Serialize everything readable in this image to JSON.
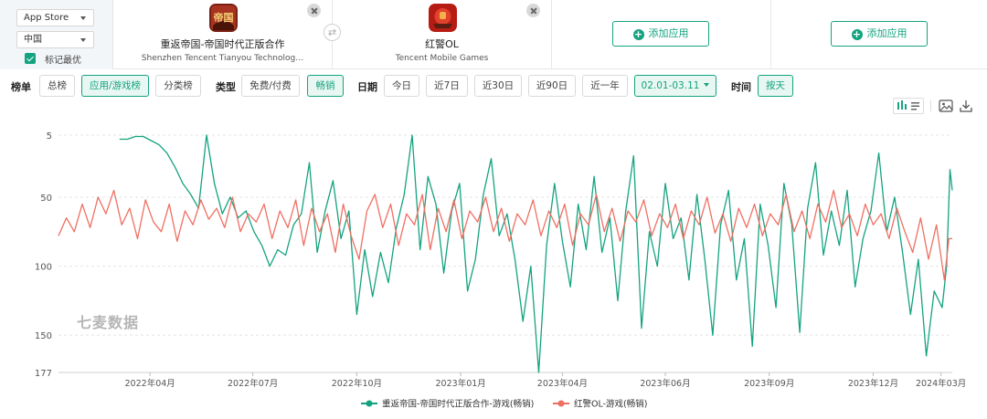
{
  "store_select": {
    "value": "App Store"
  },
  "region_select": {
    "value": "中国"
  },
  "mark_best": {
    "label": "标记最优",
    "checked": true
  },
  "apps": [
    {
      "name": "重返帝国-帝国时代正版合作",
      "developer": "Shenzhen Tencent Tianyou Technolog…",
      "icon": "icon-empire-game"
    },
    {
      "name": "红警OL",
      "developer": "Tencent Mobile Games",
      "icon": "icon-red-alert-game"
    }
  ],
  "add_app_label": "添加应用",
  "filters": {
    "chart_label": "榜单",
    "chart_options": [
      "总榜",
      "应用/游戏榜",
      "分类榜"
    ],
    "chart_selected": "应用/游戏榜",
    "type_label": "类型",
    "type_options": [
      "免费/付费",
      "畅销"
    ],
    "type_selected": "畅销",
    "date_label": "日期",
    "date_options": [
      "今日",
      "近7日",
      "近30日",
      "近90日",
      "近一年"
    ],
    "date_range": "02.01-03.11",
    "time_label": "时间",
    "time_selected": "按天"
  },
  "colors": {
    "accent": "#14a37f",
    "series1": "#14a37f",
    "series2": "#ef6f63"
  },
  "watermark": "七麦数据",
  "chart_data": {
    "type": "line",
    "y_inverted": true,
    "ylim": [
      5,
      177
    ],
    "y_ticks": [
      5,
      50,
      100,
      150,
      177
    ],
    "x_range": [
      "2022-01-10",
      "2024-03-11"
    ],
    "x_ticks": [
      {
        "date": "2022-04-01",
        "label": "2022年04月"
      },
      {
        "date": "2022-07-01",
        "label": "2022年07月"
      },
      {
        "date": "2022-10-01",
        "label": "2022年10月"
      },
      {
        "date": "2023-01-01",
        "label": "2023年01月"
      },
      {
        "date": "2023-04-01",
        "label": "2023年04月"
      },
      {
        "date": "2023-07-01",
        "label": "2023年06月"
      },
      {
        "date": "2023-10-01",
        "label": "2023年09月"
      },
      {
        "date": "2024-01-01",
        "label": "2023年12月"
      },
      {
        "date": "2024-03-01",
        "label": "2024年03月"
      }
    ],
    "grid": true,
    "legend_position": "bottom",
    "series": [
      {
        "name": "重返帝国-帝国时代正版合作-游戏(畅销)",
        "color": "#14a37f",
        "points": [
          [
            "2022-03-05",
            8
          ],
          [
            "2022-03-12",
            8
          ],
          [
            "2022-03-19",
            6
          ],
          [
            "2022-03-26",
            6
          ],
          [
            "2022-04-02",
            9
          ],
          [
            "2022-04-09",
            12
          ],
          [
            "2022-04-16",
            18
          ],
          [
            "2022-04-23",
            28
          ],
          [
            "2022-04-30",
            40
          ],
          [
            "2022-05-07",
            48
          ],
          [
            "2022-05-14",
            58
          ],
          [
            "2022-05-21",
            5
          ],
          [
            "2022-05-28",
            40
          ],
          [
            "2022-06-04",
            62
          ],
          [
            "2022-06-11",
            50
          ],
          [
            "2022-06-18",
            65
          ],
          [
            "2022-06-25",
            60
          ],
          [
            "2022-07-02",
            75
          ],
          [
            "2022-07-09",
            85
          ],
          [
            "2022-07-16",
            100
          ],
          [
            "2022-07-23",
            88
          ],
          [
            "2022-07-30",
            92
          ],
          [
            "2022-08-06",
            70
          ],
          [
            "2022-08-13",
            62
          ],
          [
            "2022-08-20",
            25
          ],
          [
            "2022-08-27",
            90
          ],
          [
            "2022-09-03",
            60
          ],
          [
            "2022-09-10",
            38
          ],
          [
            "2022-09-17",
            80
          ],
          [
            "2022-09-24",
            60
          ],
          [
            "2022-10-01",
            135
          ],
          [
            "2022-10-08",
            88
          ],
          [
            "2022-10-15",
            122
          ],
          [
            "2022-10-22",
            90
          ],
          [
            "2022-10-29",
            112
          ],
          [
            "2022-11-05",
            72
          ],
          [
            "2022-11-12",
            48
          ],
          [
            "2022-11-19",
            5
          ],
          [
            "2022-11-26",
            88
          ],
          [
            "2022-12-03",
            35
          ],
          [
            "2022-12-10",
            55
          ],
          [
            "2022-12-17",
            105
          ],
          [
            "2022-12-24",
            60
          ],
          [
            "2022-12-31",
            40
          ],
          [
            "2023-01-07",
            118
          ],
          [
            "2023-01-14",
            95
          ],
          [
            "2023-01-21",
            48
          ],
          [
            "2023-01-28",
            22
          ],
          [
            "2023-02-04",
            78
          ],
          [
            "2023-02-11",
            62
          ],
          [
            "2023-02-18",
            95
          ],
          [
            "2023-02-25",
            140
          ],
          [
            "2023-03-04",
            100
          ],
          [
            "2023-03-11",
            177
          ],
          [
            "2023-03-18",
            85
          ],
          [
            "2023-03-25",
            40
          ],
          [
            "2023-04-01",
            82
          ],
          [
            "2023-04-08",
            115
          ],
          [
            "2023-04-15",
            55
          ],
          [
            "2023-04-22",
            88
          ],
          [
            "2023-04-29",
            35
          ],
          [
            "2023-05-06",
            90
          ],
          [
            "2023-05-13",
            65
          ],
          [
            "2023-05-20",
            125
          ],
          [
            "2023-05-27",
            60
          ],
          [
            "2023-06-03",
            20
          ],
          [
            "2023-06-10",
            145
          ],
          [
            "2023-06-17",
            75
          ],
          [
            "2023-06-24",
            100
          ],
          [
            "2023-07-01",
            40
          ],
          [
            "2023-07-08",
            80
          ],
          [
            "2023-07-15",
            65
          ],
          [
            "2023-07-22",
            110
          ],
          [
            "2023-07-29",
            48
          ],
          [
            "2023-08-05",
            95
          ],
          [
            "2023-08-12",
            150
          ],
          [
            "2023-08-19",
            70
          ],
          [
            "2023-08-26",
            45
          ],
          [
            "2023-09-02",
            110
          ],
          [
            "2023-09-09",
            80
          ],
          [
            "2023-09-16",
            158
          ],
          [
            "2023-09-23",
            55
          ],
          [
            "2023-09-30",
            85
          ],
          [
            "2023-10-07",
            130
          ],
          [
            "2023-10-14",
            40
          ],
          [
            "2023-10-21",
            70
          ],
          [
            "2023-10-28",
            148
          ],
          [
            "2023-11-04",
            58
          ],
          [
            "2023-11-11",
            25
          ],
          [
            "2023-11-18",
            92
          ],
          [
            "2023-11-25",
            60
          ],
          [
            "2023-12-02",
            85
          ],
          [
            "2023-12-09",
            45
          ],
          [
            "2023-12-16",
            115
          ],
          [
            "2023-12-23",
            80
          ],
          [
            "2023-12-30",
            60
          ],
          [
            "2024-01-06",
            18
          ],
          [
            "2024-01-13",
            75
          ],
          [
            "2024-01-20",
            50
          ],
          [
            "2024-01-27",
            90
          ],
          [
            "2024-02-03",
            135
          ],
          [
            "2024-02-10",
            95
          ],
          [
            "2024-02-17",
            165
          ],
          [
            "2024-02-24",
            118
          ],
          [
            "2024-03-02",
            130
          ],
          [
            "2024-03-06",
            100
          ],
          [
            "2024-03-09",
            30
          ],
          [
            "2024-03-11",
            45
          ]
        ]
      },
      {
        "name": "红警OL-游戏(畅销)",
        "color": "#ef6f63",
        "points": [
          [
            "2022-01-10",
            78
          ],
          [
            "2022-01-17",
            65
          ],
          [
            "2022-01-24",
            75
          ],
          [
            "2022-01-31",
            55
          ],
          [
            "2022-02-07",
            72
          ],
          [
            "2022-02-14",
            50
          ],
          [
            "2022-02-21",
            62
          ],
          [
            "2022-02-28",
            45
          ],
          [
            "2022-03-07",
            70
          ],
          [
            "2022-03-14",
            58
          ],
          [
            "2022-03-21",
            80
          ],
          [
            "2022-03-28",
            52
          ],
          [
            "2022-04-04",
            68
          ],
          [
            "2022-04-11",
            75
          ],
          [
            "2022-04-18",
            55
          ],
          [
            "2022-04-25",
            82
          ],
          [
            "2022-05-02",
            60
          ],
          [
            "2022-05-09",
            70
          ],
          [
            "2022-05-16",
            52
          ],
          [
            "2022-05-23",
            66
          ],
          [
            "2022-05-30",
            58
          ],
          [
            "2022-06-06",
            72
          ],
          [
            "2022-06-13",
            50
          ],
          [
            "2022-06-20",
            75
          ],
          [
            "2022-06-27",
            62
          ],
          [
            "2022-07-04",
            68
          ],
          [
            "2022-07-11",
            55
          ],
          [
            "2022-07-18",
            80
          ],
          [
            "2022-07-25",
            60
          ],
          [
            "2022-08-01",
            72
          ],
          [
            "2022-08-08",
            52
          ],
          [
            "2022-08-15",
            85
          ],
          [
            "2022-08-22",
            58
          ],
          [
            "2022-08-29",
            75
          ],
          [
            "2022-09-05",
            62
          ],
          [
            "2022-09-12",
            90
          ],
          [
            "2022-09-19",
            55
          ],
          [
            "2022-09-26",
            78
          ],
          [
            "2022-10-03",
            95
          ],
          [
            "2022-10-10",
            60
          ],
          [
            "2022-10-17",
            48
          ],
          [
            "2022-10-24",
            72
          ],
          [
            "2022-10-31",
            55
          ],
          [
            "2022-11-07",
            85
          ],
          [
            "2022-11-14",
            62
          ],
          [
            "2022-11-21",
            70
          ],
          [
            "2022-11-28",
            48
          ],
          [
            "2022-12-05",
            88
          ],
          [
            "2022-12-12",
            58
          ],
          [
            "2022-12-19",
            75
          ],
          [
            "2022-12-26",
            52
          ],
          [
            "2023-01-02",
            80
          ],
          [
            "2023-01-09",
            60
          ],
          [
            "2023-01-16",
            68
          ],
          [
            "2023-01-23",
            50
          ],
          [
            "2023-01-30",
            75
          ],
          [
            "2023-02-06",
            58
          ],
          [
            "2023-02-13",
            82
          ],
          [
            "2023-02-20",
            62
          ],
          [
            "2023-02-27",
            70
          ],
          [
            "2023-03-06",
            52
          ],
          [
            "2023-03-13",
            78
          ],
          [
            "2023-03-20",
            60
          ],
          [
            "2023-03-27",
            72
          ],
          [
            "2023-04-03",
            55
          ],
          [
            "2023-04-10",
            85
          ],
          [
            "2023-04-17",
            62
          ],
          [
            "2023-04-24",
            70
          ],
          [
            "2023-05-01",
            48
          ],
          [
            "2023-05-08",
            75
          ],
          [
            "2023-05-15",
            58
          ],
          [
            "2023-05-22",
            82
          ],
          [
            "2023-05-29",
            60
          ],
          [
            "2023-06-05",
            68
          ],
          [
            "2023-06-12",
            52
          ],
          [
            "2023-06-19",
            78
          ],
          [
            "2023-06-26",
            62
          ],
          [
            "2023-07-03",
            72
          ],
          [
            "2023-07-10",
            55
          ],
          [
            "2023-07-17",
            80
          ],
          [
            "2023-07-24",
            60
          ],
          [
            "2023-07-31",
            70
          ],
          [
            "2023-08-07",
            50
          ],
          [
            "2023-08-14",
            76
          ],
          [
            "2023-08-21",
            62
          ],
          [
            "2023-08-28",
            82
          ],
          [
            "2023-09-04",
            58
          ],
          [
            "2023-09-11",
            72
          ],
          [
            "2023-09-18",
            55
          ],
          [
            "2023-09-25",
            78
          ],
          [
            "2023-10-02",
            62
          ],
          [
            "2023-10-09",
            70
          ],
          [
            "2023-10-16",
            48
          ],
          [
            "2023-10-23",
            75
          ],
          [
            "2023-10-30",
            60
          ],
          [
            "2023-11-06",
            80
          ],
          [
            "2023-11-13",
            55
          ],
          [
            "2023-11-20",
            68
          ],
          [
            "2023-11-27",
            45
          ],
          [
            "2023-12-04",
            72
          ],
          [
            "2023-12-11",
            62
          ],
          [
            "2023-12-18",
            78
          ],
          [
            "2023-12-25",
            55
          ],
          [
            "2024-01-01",
            70
          ],
          [
            "2024-01-08",
            62
          ],
          [
            "2024-01-15",
            80
          ],
          [
            "2024-01-22",
            58
          ],
          [
            "2024-01-29",
            75
          ],
          [
            "2024-02-05",
            90
          ],
          [
            "2024-02-12",
            65
          ],
          [
            "2024-02-19",
            95
          ],
          [
            "2024-02-26",
            70
          ],
          [
            "2024-03-04",
            110
          ],
          [
            "2024-03-08",
            80
          ],
          [
            "2024-03-11",
            80
          ]
        ]
      }
    ]
  }
}
